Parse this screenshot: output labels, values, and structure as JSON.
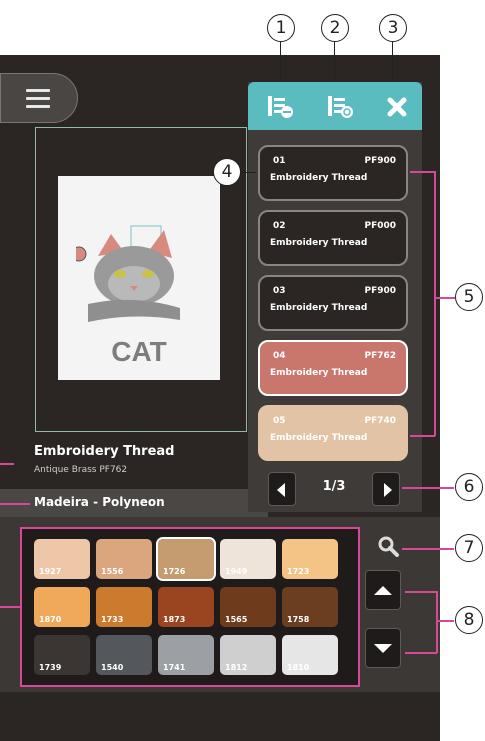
{
  "callouts": [
    "1",
    "2",
    "3",
    "4",
    "5",
    "6",
    "7",
    "8"
  ],
  "preview": {
    "image_text": "CAT"
  },
  "selected_thread": {
    "name": "Embroidery Thread",
    "detail": "Antique Brass PF762"
  },
  "brand": "Madeira - Polyneon",
  "thread_list": [
    {
      "num": "01",
      "code": "PF900",
      "label": "Embroidery Thread",
      "color": "#2b2523",
      "border": "#8a8583"
    },
    {
      "num": "02",
      "code": "PF000",
      "label": "Embroidery Thread",
      "color": "#2b2523",
      "border": "#8a8583"
    },
    {
      "num": "03",
      "code": "PF900",
      "label": "Embroidery Thread",
      "color": "#2b2523",
      "border": "#8a8583"
    },
    {
      "num": "04",
      "code": "PF762",
      "label": "Embroidery Thread",
      "color": "#c9776c",
      "border": "#ffffff"
    },
    {
      "num": "05",
      "code": "PF740",
      "label": "Embroidery Thread",
      "color": "#e2c3a6",
      "border": "#e2c3a6"
    }
  ],
  "pager": {
    "text": "1/3"
  },
  "swatches": [
    {
      "code": "1927",
      "color": "#edc7a8"
    },
    {
      "code": "1556",
      "color": "#dba57d"
    },
    {
      "code": "1726",
      "color": "#c59b70",
      "selected": true
    },
    {
      "code": "1949",
      "color": "#eee4da"
    },
    {
      "code": "1723",
      "color": "#f4c386"
    },
    {
      "code": "1870",
      "color": "#f0a95b"
    },
    {
      "code": "1733",
      "color": "#cc7b2e"
    },
    {
      "code": "1873",
      "color": "#9a4420"
    },
    {
      "code": "1565",
      "color": "#6e3b1d"
    },
    {
      "code": "1758",
      "color": "#6b3e1f"
    },
    {
      "code": "1739",
      "color": "#3b3533"
    },
    {
      "code": "1540",
      "color": "#54575c"
    },
    {
      "code": "1741",
      "color": "#9ca0a4"
    },
    {
      "code": "1812",
      "color": "#cfcfcf"
    },
    {
      "code": "1810",
      "color": "#e6e6e6"
    }
  ],
  "colors": {
    "toolbar": "#5bbcc0",
    "highlight": "#d7489a",
    "background": "#2b2523"
  },
  "icons": [
    "menu-icon",
    "thread-list-icon",
    "thread-sort-icon",
    "close-icon",
    "search-icon",
    "arrow-up-icon",
    "arrow-down-icon",
    "arrow-left-icon",
    "arrow-right-icon"
  ]
}
